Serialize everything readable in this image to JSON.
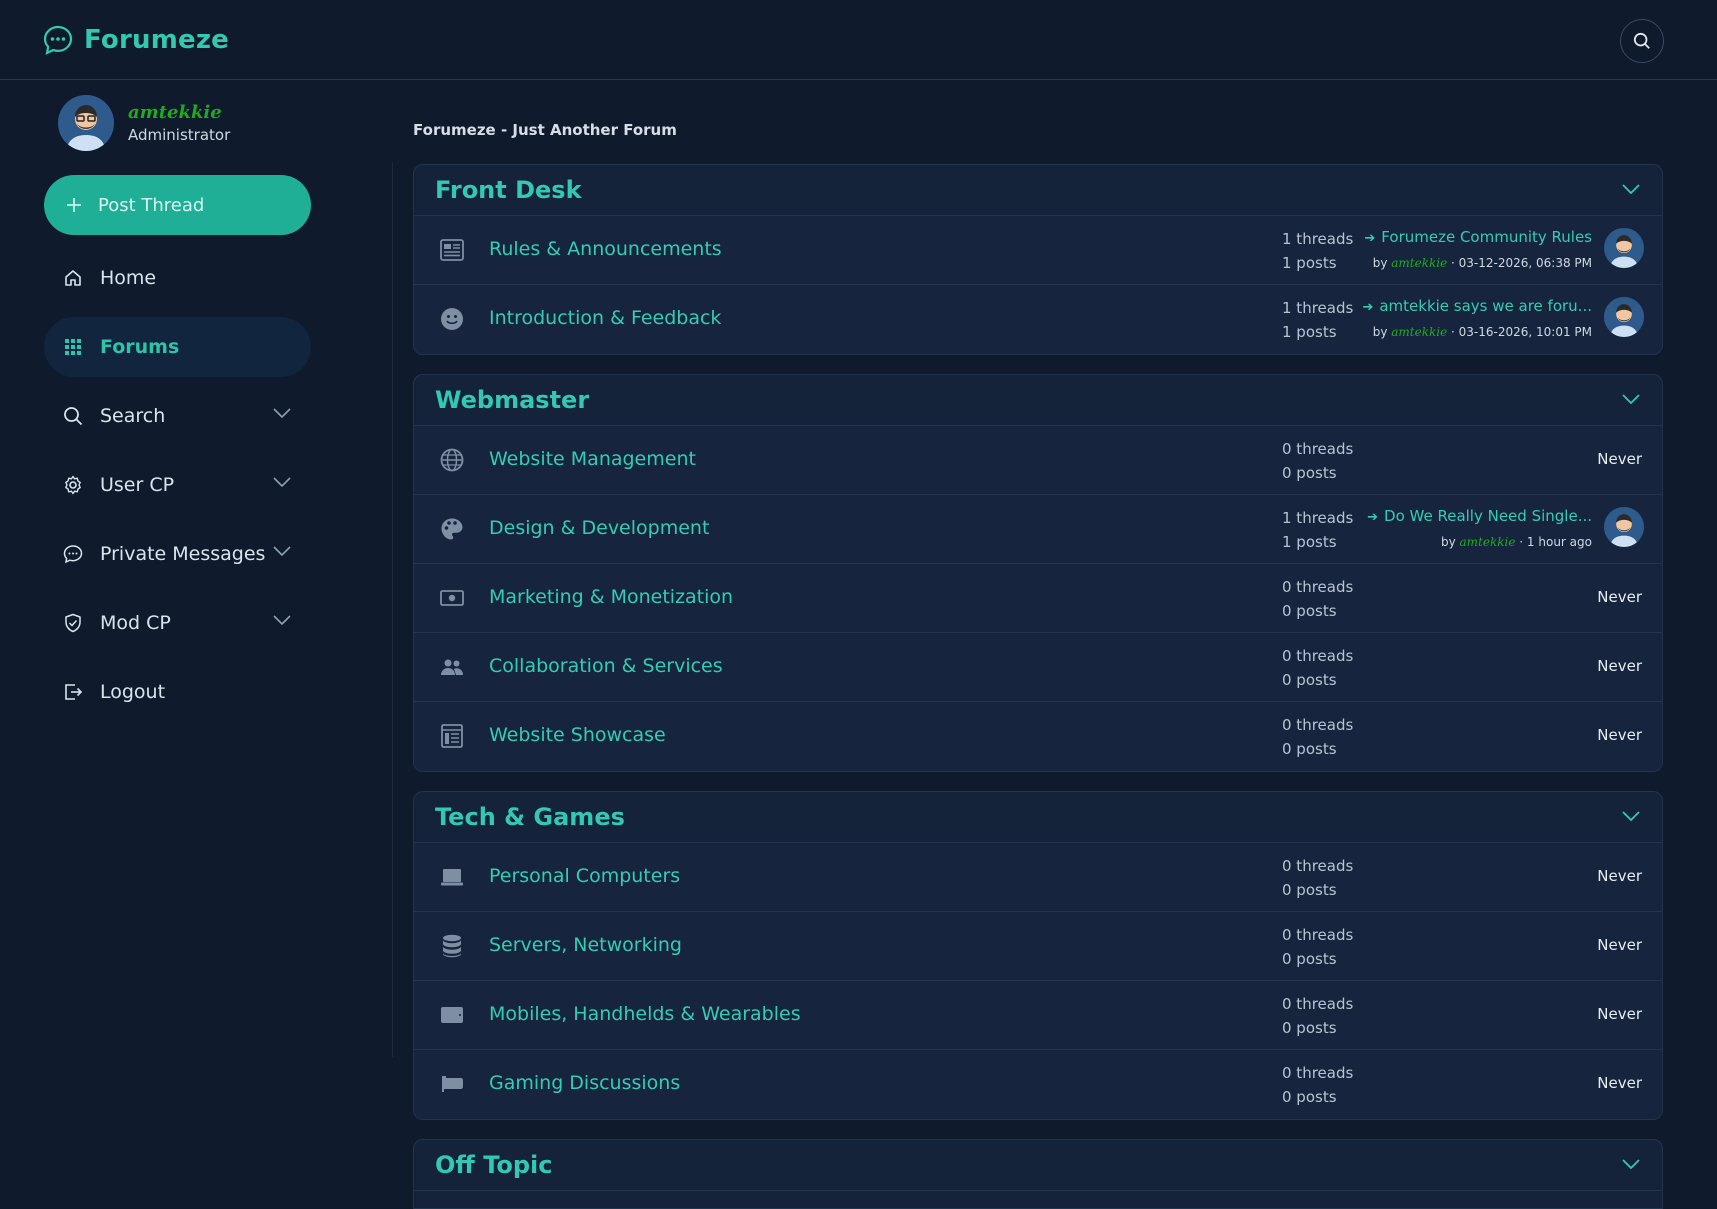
{
  "header": {
    "brand": "Forumeze"
  },
  "user": {
    "name": "amtekkie",
    "role": "Administrator"
  },
  "sidebar": {
    "post_thread_label": "Post Thread",
    "items": [
      {
        "label": "Home"
      },
      {
        "label": "Forums"
      },
      {
        "label": "Search"
      },
      {
        "label": "User CP"
      },
      {
        "label": "Private Messages"
      },
      {
        "label": "Mod CP"
      },
      {
        "label": "Logout"
      }
    ]
  },
  "breadcrumb": "Forumeze - Just Another Forum",
  "categories": [
    {
      "title": "Front Desk",
      "forums": [
        {
          "name": "Rules & Announcements",
          "threads": "1 threads",
          "posts": "1 posts",
          "last_title": "Forumeze Community Rules",
          "by": "by",
          "last_user": "amtekkie",
          "last_time": " · 03-12-2026, 06:38 PM"
        },
        {
          "name": "Introduction & Feedback",
          "threads": "1 threads",
          "posts": "1 posts",
          "last_title": "amtekkie says we are foru...",
          "by": "by",
          "last_user": "amtekkie",
          "last_time": " · 03-16-2026, 10:01 PM"
        }
      ]
    },
    {
      "title": "Webmaster",
      "forums": [
        {
          "name": "Website Management",
          "threads": "0 threads",
          "posts": "0 posts",
          "never": "Never"
        },
        {
          "name": "Design & Development",
          "threads": "1 threads",
          "posts": "1 posts",
          "last_title": "Do We Really Need Single...",
          "by": "by",
          "last_user": "amtekkie",
          "last_time": " · 1 hour ago"
        },
        {
          "name": "Marketing & Monetization",
          "threads": "0 threads",
          "posts": "0 posts",
          "never": "Never"
        },
        {
          "name": "Collaboration & Services",
          "threads": "0 threads",
          "posts": "0 posts",
          "never": "Never"
        },
        {
          "name": "Website Showcase",
          "threads": "0 threads",
          "posts": "0 posts",
          "never": "Never"
        }
      ]
    },
    {
      "title": "Tech & Games",
      "forums": [
        {
          "name": "Personal Computers",
          "threads": "0 threads",
          "posts": "0 posts",
          "never": "Never"
        },
        {
          "name": "Servers, Networking",
          "threads": "0 threads",
          "posts": "0 posts",
          "never": "Never"
        },
        {
          "name": "Mobiles, Handhelds & Wearables",
          "threads": "0 threads",
          "posts": "0 posts",
          "never": "Never"
        },
        {
          "name": "Gaming Discussions",
          "threads": "0 threads",
          "posts": "0 posts",
          "never": "Never"
        }
      ]
    },
    {
      "title": "Off Topic",
      "forums": []
    }
  ],
  "icons": {
    "brand": "chat-bubble-icon",
    "search": "search-icon",
    "forums": [
      "newspaper-icon",
      "smiley-icon",
      "globe-icon",
      "palette-icon",
      "money-icon",
      "people-icon",
      "list-icon",
      "laptop-icon",
      "database-icon",
      "tablet-icon",
      "gamepad-icon"
    ]
  },
  "colors": {
    "accent": "#32c9b0",
    "background": "#0f1a2c",
    "panel": "#14223a",
    "user": "#1faa1f"
  }
}
